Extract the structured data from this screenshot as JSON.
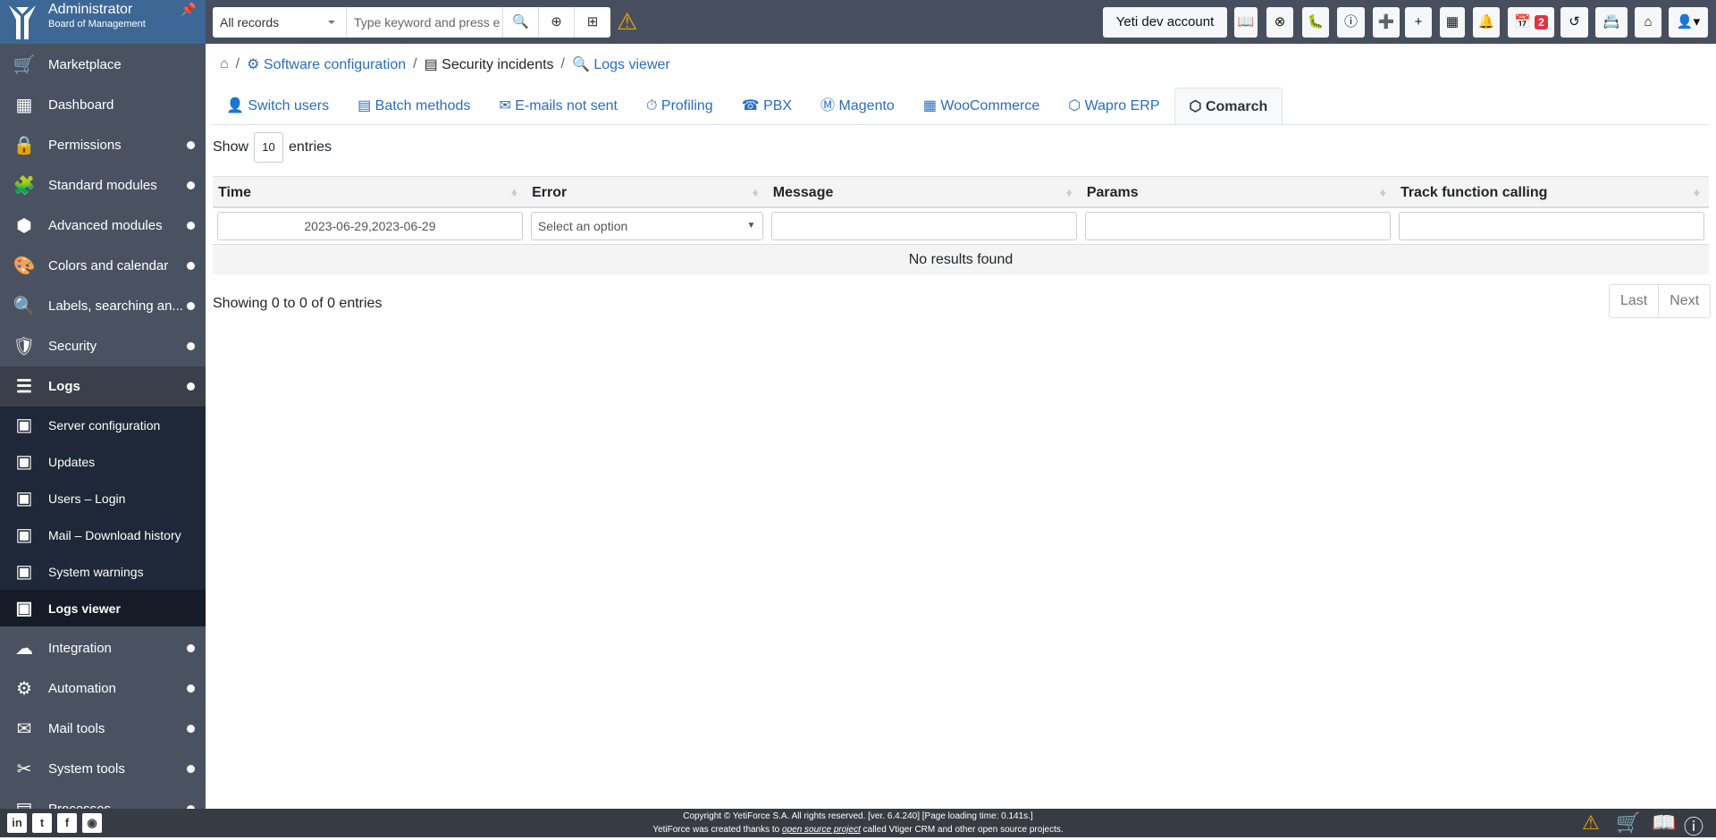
{
  "user": {
    "name": "Administrator",
    "role": "Board of Management"
  },
  "search": {
    "module": "All records",
    "placeholder": "Type keyword and press e"
  },
  "header": {
    "dev_account": "Yeti dev account",
    "calendar_badge": "2"
  },
  "sidebar": {
    "items": [
      {
        "label": "Marketplace",
        "icon": "cart-icon",
        "expandable": false
      },
      {
        "label": "Dashboard",
        "icon": "dashboard-icon",
        "expandable": false
      },
      {
        "label": "Permissions",
        "icon": "lock-icon",
        "expandable": true
      },
      {
        "label": "Standard modules",
        "icon": "puzzle-icon",
        "expandable": true
      },
      {
        "label": "Advanced modules",
        "icon": "cube-icon",
        "expandable": true
      },
      {
        "label": "Colors and calendar",
        "icon": "palette-icon",
        "expandable": true
      },
      {
        "label": "Labels, searching an...",
        "icon": "search-label-icon",
        "expandable": true
      },
      {
        "label": "Security",
        "icon": "shield-icon",
        "expandable": true
      },
      {
        "label": "Logs",
        "icon": "server-icon",
        "expandable": true
      }
    ],
    "logs_sub": [
      {
        "label": "Server configuration"
      },
      {
        "label": "Updates"
      },
      {
        "label": "Users – Login"
      },
      {
        "label": "Mail – Download history"
      },
      {
        "label": "System warnings"
      },
      {
        "label": "Logs viewer"
      }
    ],
    "items_after": [
      {
        "label": "Integration",
        "icon": "cloud-icon"
      },
      {
        "label": "Automation",
        "icon": "cogs-icon"
      },
      {
        "label": "Mail tools",
        "icon": "mail-tools-icon"
      },
      {
        "label": "System tools",
        "icon": "tools-icon"
      },
      {
        "label": "Processes",
        "icon": "processes-icon"
      }
    ]
  },
  "breadcrumb": {
    "l1": "Software configuration",
    "l2": "Security incidents",
    "l3": "Logs viewer"
  },
  "tabs": [
    "Switch users",
    "Batch methods",
    "E-mails not sent",
    "Profiling",
    "PBX",
    "Magento",
    "WooCommerce",
    "Wapro ERP",
    "Comarch"
  ],
  "active_tab": "Comarch",
  "table": {
    "show": "Show",
    "length": "10",
    "entries": "entries",
    "columns": [
      "Time",
      "Error",
      "Message",
      "Params",
      "Track function calling"
    ],
    "time_filter": "2023-06-29,2023-06-29",
    "error_placeholder": "Select an option",
    "empty": "No results found",
    "info": "Showing 0 to 0 of 0 entries",
    "last": "Last",
    "next": "Next"
  },
  "footer": {
    "line1": "Copyright © YetiForce S.A. All rights reserved. [ver. 6.4.240] [Page loading time: 0.141s.]",
    "line2a": "YetiForce was created thanks to ",
    "line2link": "open source project",
    "line2b": " called Vtiger CRM and other open source projects."
  },
  "colors": {
    "accent": "#2a6ebb",
    "brand": "#3d6895",
    "topbar": "#474f5e",
    "badge": "#dc3545"
  }
}
